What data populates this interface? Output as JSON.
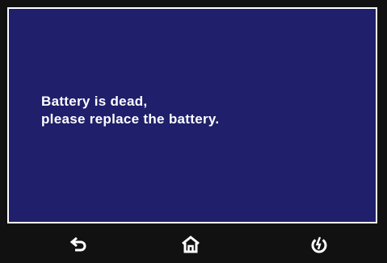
{
  "message": {
    "line1": "Battery is dead,",
    "line2": "please replace the battery."
  },
  "nav": {
    "back_icon": "back-arrow-icon",
    "home_icon": "home-icon",
    "power_icon": "power-icon"
  },
  "colors": {
    "screen_background": "#1f1f6b",
    "frame": "#111111",
    "text": "#ffffff"
  }
}
